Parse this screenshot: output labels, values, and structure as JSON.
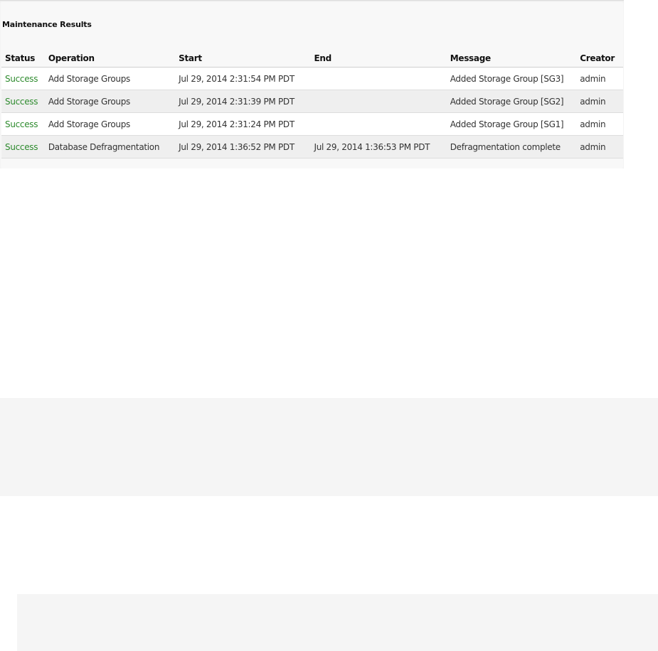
{
  "maintenance": {
    "title": "Maintenance Results",
    "columns": {
      "status": "Status",
      "operation": "Operation",
      "start": "Start",
      "end": "End",
      "message": "Message",
      "creator": "Creator"
    },
    "rows": [
      {
        "status": "Success",
        "operation": "Add Storage Groups",
        "start": "Jul 29, 2014 2:31:54 PM PDT",
        "end": "",
        "message": "Added Storage Group [SG3]",
        "creator": "admin"
      },
      {
        "status": "Success",
        "operation": "Add Storage Groups",
        "start": "Jul 29, 2014 2:31:39 PM PDT",
        "end": "",
        "message": "Added Storage Group [SG2]",
        "creator": "admin"
      },
      {
        "status": "Success",
        "operation": "Add Storage Groups",
        "start": "Jul 29, 2014 2:31:24 PM PDT",
        "end": "",
        "message": "Added Storage Group [SG1]",
        "creator": "admin"
      },
      {
        "status": "Success",
        "operation": "Database Defragmentation",
        "start": "Jul 29, 2014 1:36:52 PM PDT",
        "end": "Jul 29, 2014 1:36:53 PM PDT",
        "message": "Defragmentation complete",
        "creator": "admin"
      }
    ]
  },
  "colors": {
    "success": "#2e8b2e",
    "panel_bg": "#f8f8f8",
    "row_alt_bg": "#efefef"
  }
}
